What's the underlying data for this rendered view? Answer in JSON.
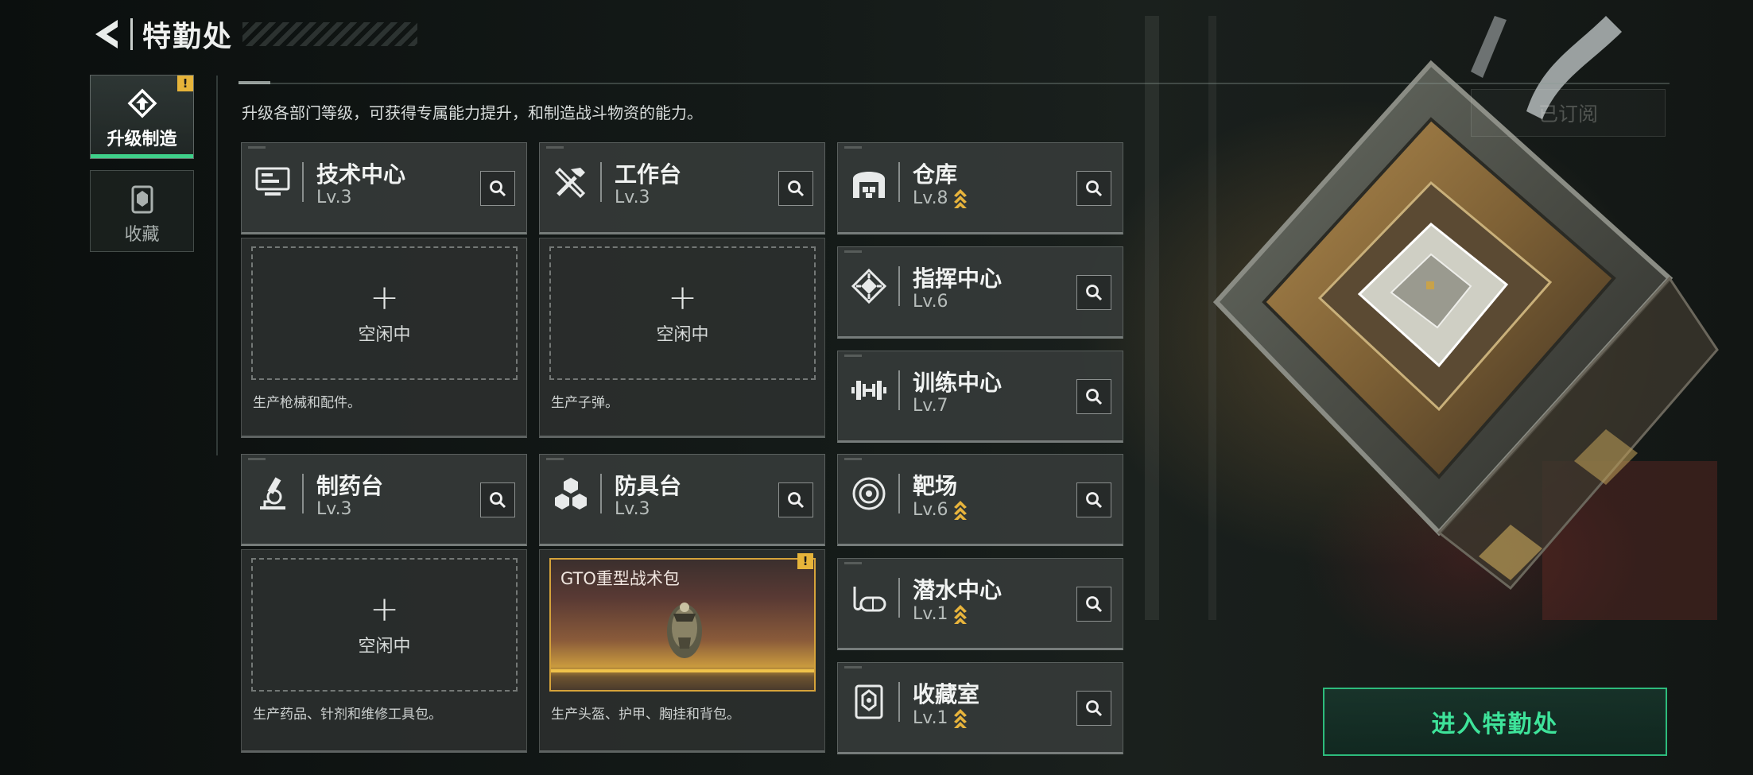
{
  "header": {
    "title": "特勤处"
  },
  "sidebar": {
    "tabs": [
      {
        "label": "升级制造",
        "icon": "upgrade-icon",
        "active": true,
        "alert": "!"
      },
      {
        "label": "收藏",
        "icon": "collection-icon",
        "active": false
      }
    ]
  },
  "subtitle": "升级各部门等级，可获得专属能力提升，和制造战斗物资的能力。",
  "subscribe_label": "已订阅",
  "enter_label": "进入特勤处",
  "slots": {
    "idle_label": "空闲中",
    "plus": "+"
  },
  "departments": {
    "tech": {
      "name": "技术中心",
      "level": "Lv.3",
      "icon": "computer-icon",
      "desc": "生产枪械和配件。"
    },
    "workbench": {
      "name": "工作台",
      "level": "Lv.3",
      "icon": "tools-icon",
      "desc": "生产子弹。"
    },
    "pharmacy": {
      "name": "制药台",
      "level": "Lv.3",
      "icon": "microscope-icon",
      "desc": "生产药品、针剂和维修工具包。"
    },
    "armor": {
      "name": "防具台",
      "level": "Lv.3",
      "icon": "cubes-icon",
      "desc": "生产头盔、护甲、胸挂和背包。",
      "crafting": {
        "item": "GTO重型战术包",
        "alert": "!"
      }
    },
    "warehouse": {
      "name": "仓库",
      "level": "Lv.8",
      "icon": "warehouse-icon",
      "upgradable": true
    },
    "command": {
      "name": "指挥中心",
      "level": "Lv.6",
      "icon": "chip-icon",
      "upgradable": false
    },
    "training": {
      "name": "训练中心",
      "level": "Lv.7",
      "icon": "dumbbell-icon",
      "upgradable": false
    },
    "range": {
      "name": "靶场",
      "level": "Lv.6",
      "icon": "target-icon",
      "upgradable": true
    },
    "diving": {
      "name": "潜水中心",
      "level": "Lv.1",
      "icon": "diving-mask-icon",
      "upgradable": true
    },
    "collection_room": {
      "name": "收藏室",
      "level": "Lv.1",
      "icon": "trophy-icon",
      "upgradable": true
    }
  },
  "colors": {
    "accent_green": "#3ee39a",
    "alert_yellow": "#e6b43a",
    "upgrade_arrow": "#e8b43c"
  }
}
